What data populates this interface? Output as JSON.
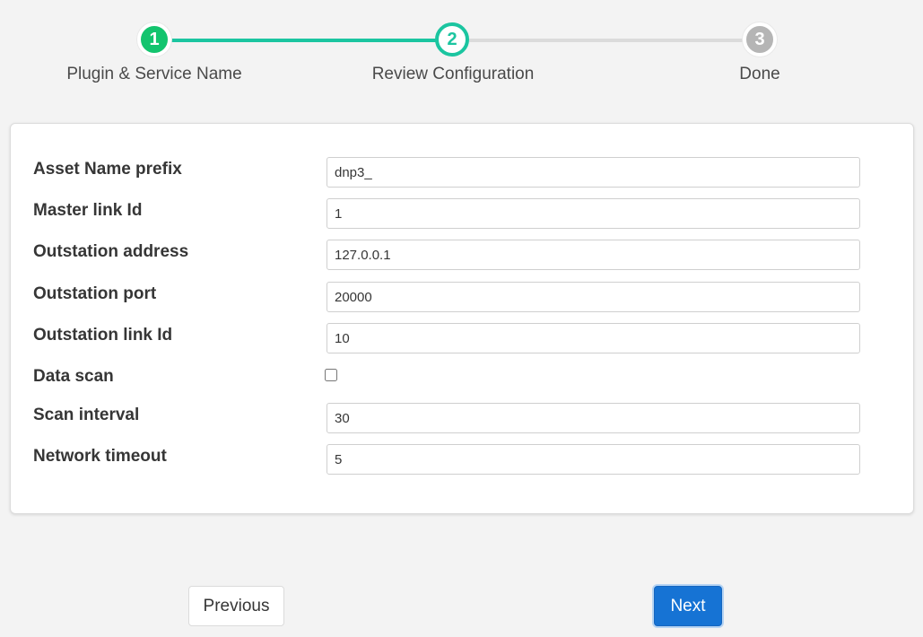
{
  "stepper": {
    "steps": [
      {
        "number": "1",
        "label": "Plugin & Service Name",
        "state": "completed"
      },
      {
        "number": "2",
        "label": "Review Configuration",
        "state": "active"
      },
      {
        "number": "3",
        "label": "Done",
        "state": "pending"
      }
    ],
    "colors": {
      "completed": "#13c46e",
      "active": "#1bc5a0",
      "pending": "#b5b5b5",
      "track_done": "#1bc5a0",
      "track_todo": "#dbdbdb"
    }
  },
  "config": {
    "fields": [
      {
        "label": "Asset Name prefix",
        "value": "dnp3_",
        "type": "text"
      },
      {
        "label": "Master link Id",
        "value": "1",
        "type": "text"
      },
      {
        "label": "Outstation address",
        "value": "127.0.0.1",
        "type": "text"
      },
      {
        "label": "Outstation port",
        "value": "20000",
        "type": "text"
      },
      {
        "label": "Outstation link Id",
        "value": "10",
        "type": "text"
      },
      {
        "label": "Data scan",
        "checked": false,
        "type": "checkbox"
      },
      {
        "label": "Scan interval",
        "value": "30",
        "type": "text"
      },
      {
        "label": "Network timeout",
        "value": "5",
        "type": "text"
      }
    ]
  },
  "buttons": {
    "previous_label": "Previous",
    "next_label": "Next",
    "next_color": "#1673d4"
  }
}
